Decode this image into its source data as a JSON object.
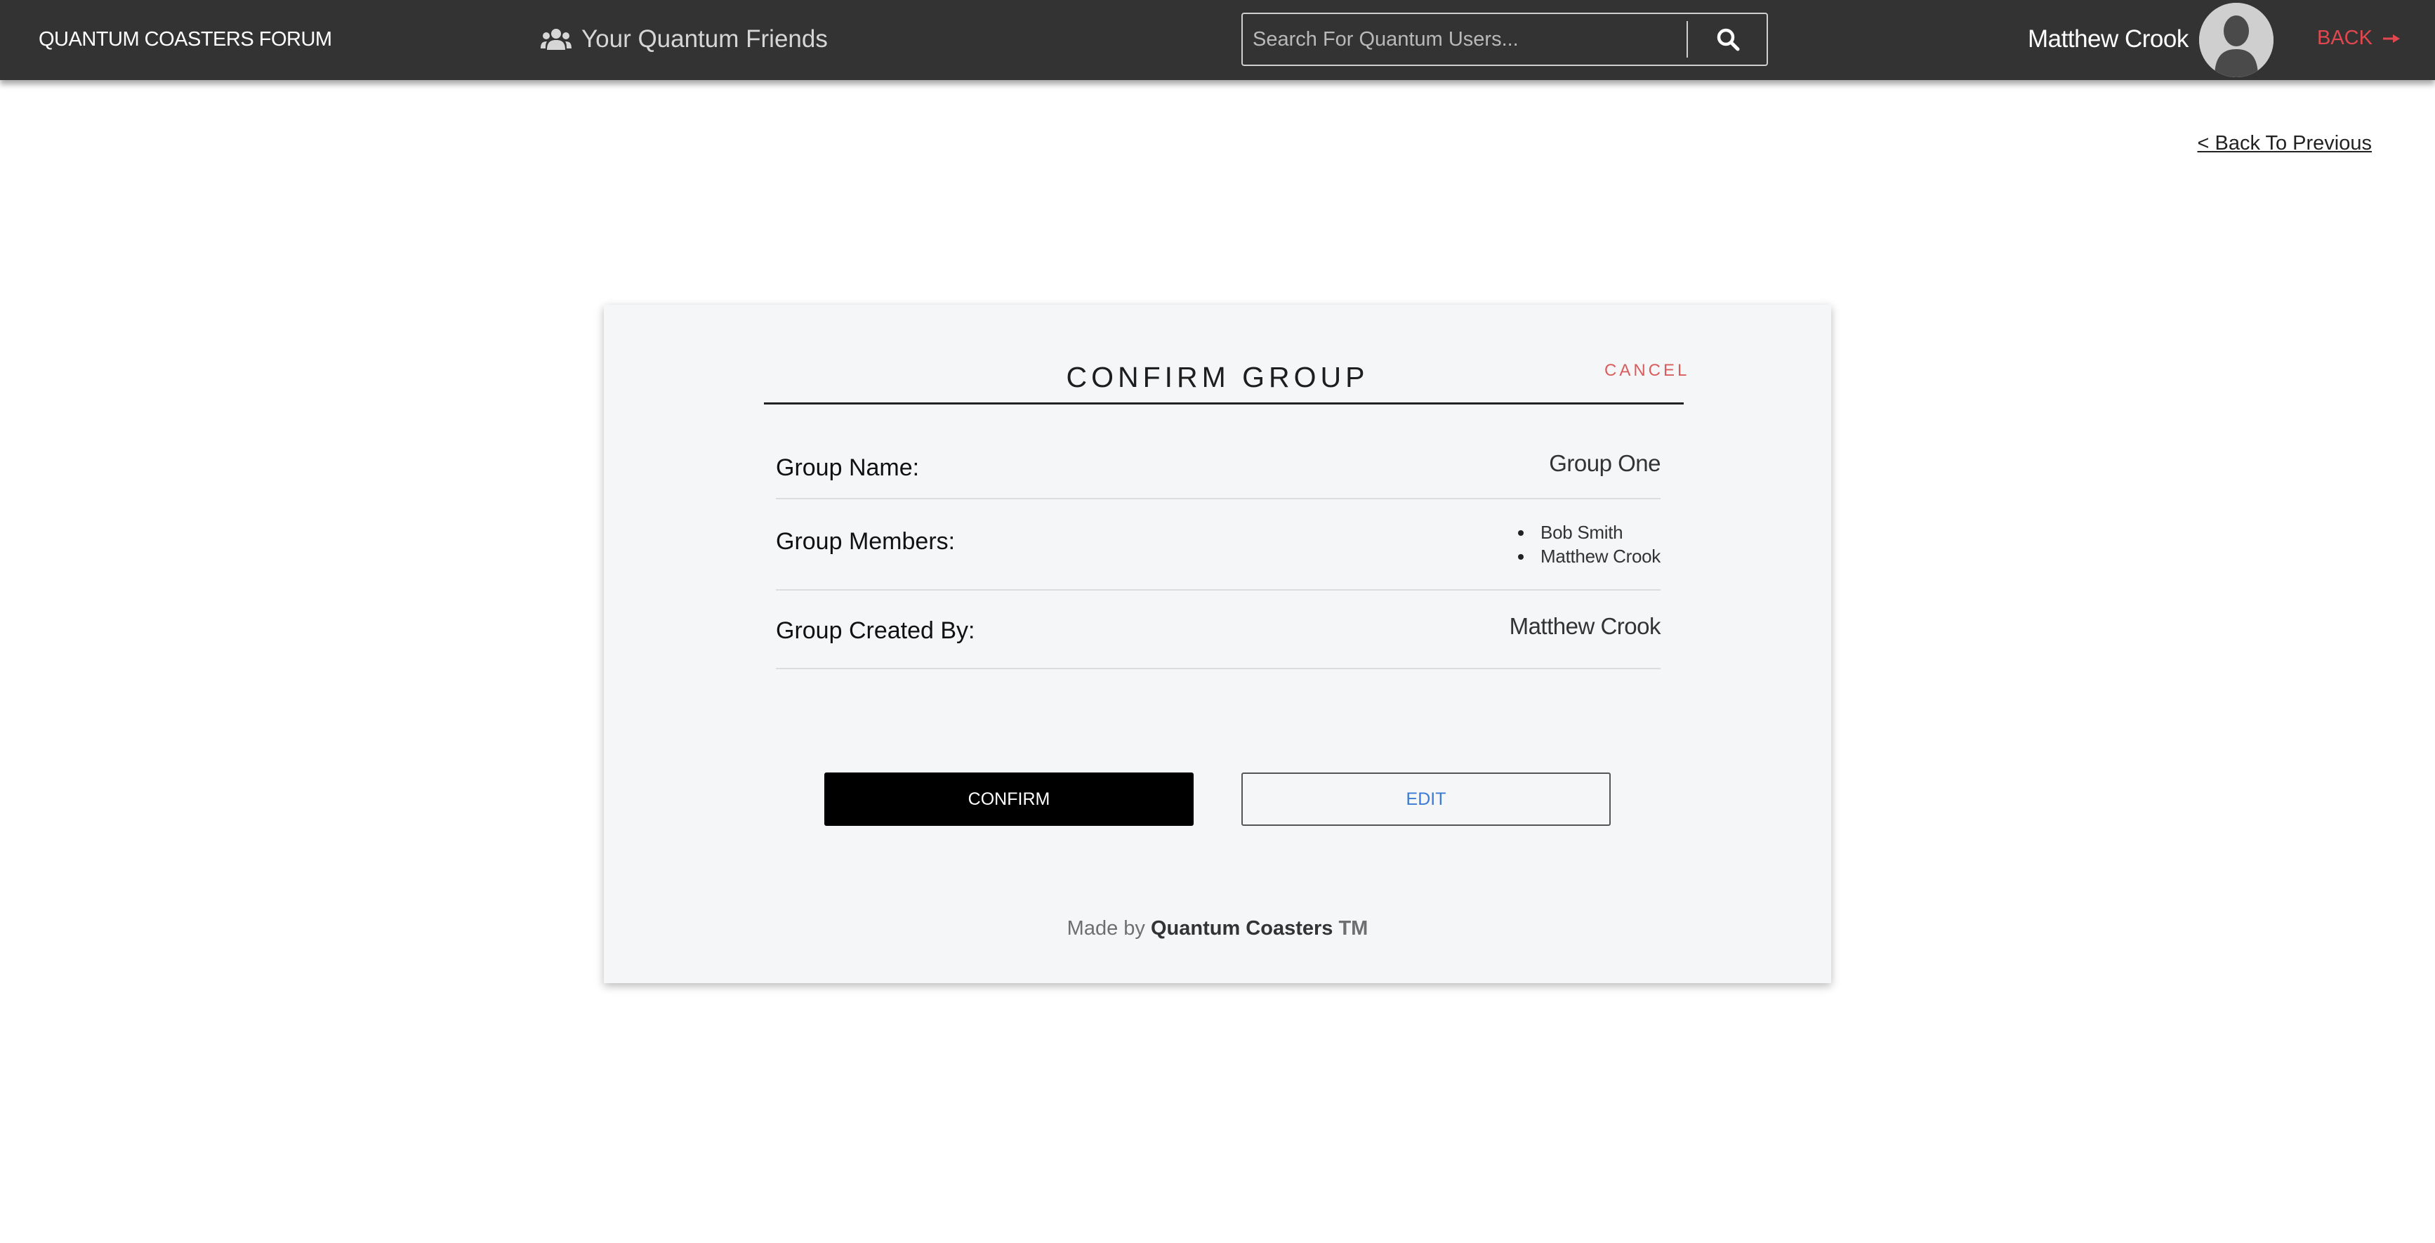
{
  "navbar": {
    "brand": "QUANTUM COASTERS FORUM",
    "friends_label": "Your Quantum Friends",
    "search_placeholder": "Search For Quantum Users...",
    "user_name": "Matthew Crook",
    "back_label": "BACK",
    "background_color": "#333333",
    "back_color": "#e0484f"
  },
  "page": {
    "back_previous": "< Back To Previous"
  },
  "card": {
    "title": "CONFIRM GROUP",
    "cancel_label": "CANCEL",
    "group_name_label": "Group Name:",
    "group_name_value": "Group One",
    "members_label": "Group Members:",
    "members": [
      "Bob Smith",
      "Matthew Crook"
    ],
    "created_by_label": "Group Created By:",
    "created_by_value": "Matthew Crook",
    "confirm_label": "CONFIRM",
    "edit_label": "EDIT",
    "footer_prefix": "Made by",
    "footer_brand": "Quantum Coasters",
    "footer_tm": "TM"
  },
  "icons": {
    "friends": "users-icon",
    "search": "search-icon",
    "avatar": "user-silhouette-icon",
    "back": "arrow-right-icon"
  }
}
